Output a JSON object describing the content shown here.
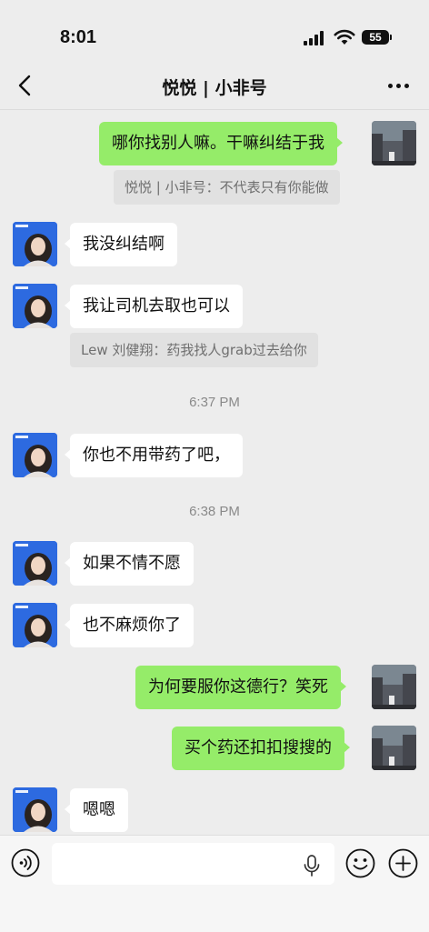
{
  "status_bar": {
    "time": "8:01",
    "battery": "55"
  },
  "nav": {
    "title": "悦悦 | 小非号"
  },
  "messages": [
    {
      "text": "哪你找别人嘛。干嘛纠结于我"
    },
    {
      "quote": "悦悦 | 小非号：不代表只有你能做"
    },
    {
      "text": "我没纠结啊"
    },
    {
      "text": "我让司机去取也可以"
    },
    {
      "quote": "Lew 刘健翔：药我找人grab过去给你"
    },
    {
      "timestamp": "6:37 PM"
    },
    {
      "text": "你也不用带药了吧，"
    },
    {
      "timestamp": "6:38 PM"
    },
    {
      "text": "如果不情不愿"
    },
    {
      "text": "也不麻烦你了"
    },
    {
      "text": "为何要服你这德行？笑死"
    },
    {
      "text": "买个药还扣扣搜搜的"
    },
    {
      "text": "嗯嗯"
    }
  ],
  "input": {
    "placeholder": ""
  },
  "colors": {
    "self_bubble": "#95ec69",
    "other_bubble": "#ffffff",
    "background": "#ededed"
  },
  "icons": [
    "back-arrow-icon",
    "more-dots-icon",
    "voice-icon",
    "microphone-icon",
    "emoji-icon",
    "plus-icon"
  ]
}
